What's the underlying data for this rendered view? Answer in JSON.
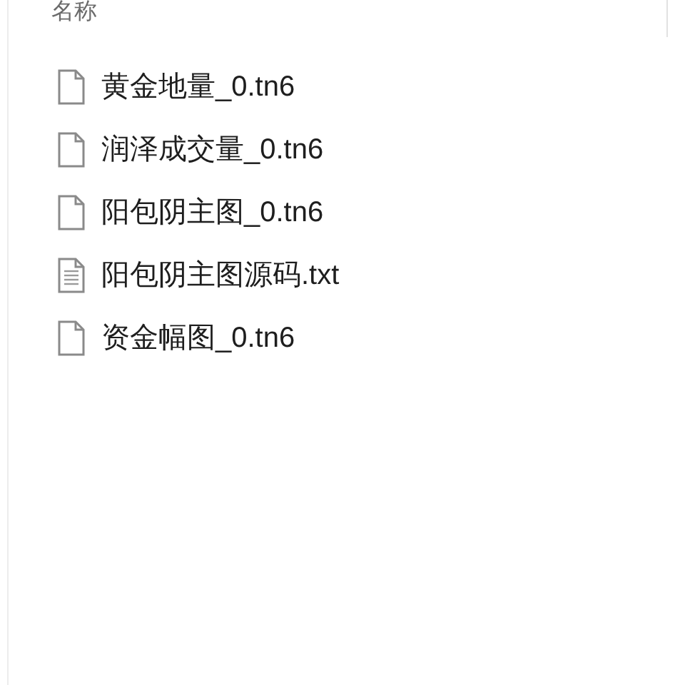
{
  "column_header": "名称",
  "files": [
    {
      "name": "黄金地量_0.tn6",
      "kind": "blank"
    },
    {
      "name": "润泽成交量_0.tn6",
      "kind": "blank"
    },
    {
      "name": "阳包阴主图_0.tn6",
      "kind": "blank"
    },
    {
      "name": "阳包阴主图源码.txt",
      "kind": "text"
    },
    {
      "name": "资金幅图_0.tn6",
      "kind": "blank"
    }
  ]
}
